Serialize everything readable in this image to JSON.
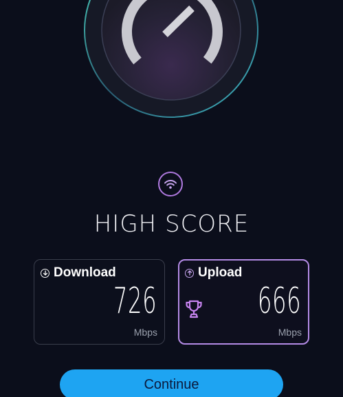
{
  "title": "HIGH SCORE",
  "gauge": {
    "needle_icon": "speedometer-needle-icon"
  },
  "wifi_icon": "wifi-icon",
  "download": {
    "label": "Download",
    "value": "726",
    "unit": "Mbps",
    "icon": "download-arrow-icon"
  },
  "upload": {
    "label": "Upload",
    "value": "666",
    "unit": "Mbps",
    "icon": "upload-arrow-icon",
    "badge_icon": "trophy-icon"
  },
  "continue_label": "Continue",
  "colors": {
    "background": "#0b0e1b",
    "accent_purple": "#b48be6",
    "button_blue": "#1ea4f2",
    "gauge_ring": "#5fd0c8"
  }
}
